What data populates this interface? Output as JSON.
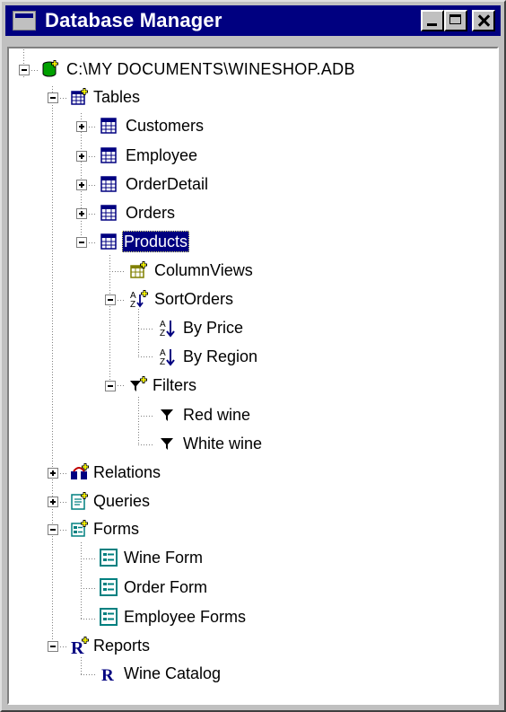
{
  "window": {
    "title": "Database Manager"
  },
  "tree": {
    "root": "C:\\MY DOCUMENTS\\WINESHOP.ADB",
    "tables": {
      "label": "Tables",
      "items": [
        "Customers",
        "Employee",
        "OrderDetail",
        "Orders"
      ],
      "selected": "Products",
      "products_children": {
        "column_views": "ColumnViews",
        "sort_orders": "SortOrders",
        "sort_items": [
          "By Price",
          "By Region"
        ],
        "filters": "Filters",
        "filter_items": [
          "Red wine",
          "White wine"
        ]
      }
    },
    "relations": "Relations",
    "queries": "Queries",
    "forms": {
      "label": "Forms",
      "items": [
        "Wine Form",
        "Order Form",
        "Employee Forms"
      ]
    },
    "reports": {
      "label": "Reports",
      "items": [
        "Wine Catalog"
      ]
    }
  },
  "colors": {
    "title_bar": "#000080",
    "selection": "#000080",
    "chrome": "#c0c0c0",
    "table_icon": "#000080",
    "form_icon": "#008080",
    "report_icon": "#000080"
  }
}
